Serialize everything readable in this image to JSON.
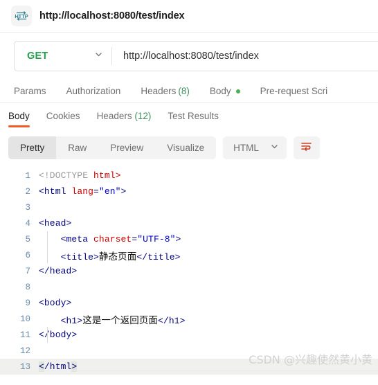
{
  "tabstrip": {
    "icon": "http-protocol-icon",
    "title": "http://localhost:8080/test/index"
  },
  "request_bar": {
    "method": "GET",
    "method_color": "#22a24c",
    "url": "http://localhost:8080/test/index",
    "chevron_icon": "chevron-down-icon"
  },
  "request_tabs": [
    {
      "label": "Params",
      "count": "",
      "dot": false,
      "active": false
    },
    {
      "label": "Authorization",
      "count": "",
      "dot": false,
      "active": false
    },
    {
      "label": "Headers",
      "count": "(8)",
      "dot": false,
      "active": false
    },
    {
      "label": "Body",
      "count": "",
      "dot": true,
      "active": false
    },
    {
      "label": "Pre-request Scri",
      "count": "",
      "dot": false,
      "active": false
    }
  ],
  "response_tabs": [
    {
      "label": "Body",
      "count": "",
      "active": true
    },
    {
      "label": "Cookies",
      "count": "",
      "active": false
    },
    {
      "label": "Headers",
      "count": "(12)",
      "active": false
    },
    {
      "label": "Test Results",
      "count": "",
      "active": false
    }
  ],
  "viewer_toolbar": {
    "modes": [
      {
        "label": "Pretty",
        "active": true
      },
      {
        "label": "Raw",
        "active": false
      },
      {
        "label": "Preview",
        "active": false
      },
      {
        "label": "Visualize",
        "active": false
      }
    ],
    "format": "HTML",
    "format_chevron_icon": "chevron-down-icon",
    "wrap_icon": "wrap-lines-icon",
    "wrap_icon_color": "#cc4125",
    "active_underline_color": "#ef5b25"
  },
  "code": {
    "language": "html",
    "lines": [
      {
        "n": "1",
        "indent": false,
        "active": false
      },
      {
        "n": "2",
        "indent": false,
        "active": false
      },
      {
        "n": "3",
        "indent": false,
        "active": false
      },
      {
        "n": "4",
        "indent": false,
        "active": false
      },
      {
        "n": "5",
        "indent": true,
        "active": false
      },
      {
        "n": "6",
        "indent": true,
        "active": false
      },
      {
        "n": "7",
        "indent": false,
        "active": false
      },
      {
        "n": "8",
        "indent": false,
        "active": false
      },
      {
        "n": "9",
        "indent": false,
        "active": false
      },
      {
        "n": "10",
        "indent": true,
        "active": false
      },
      {
        "n": "11",
        "indent": false,
        "active": false
      },
      {
        "n": "12",
        "indent": false,
        "active": false
      },
      {
        "n": "13",
        "indent": false,
        "active": true
      }
    ],
    "line_text": {
      "l1_doctype": "<!DOCTYPE ",
      "l1_html": "html>",
      "l2_a": "<html ",
      "l2_attr": "lang",
      "l2_eq": "=",
      "l2_val": "\"en\"",
      "l2_close": ">",
      "l3": "",
      "l4": "<head>",
      "l5_a": "    <meta ",
      "l5_attr": "charset",
      "l5_eq": "=",
      "l5_val": "\"UTF-8\"",
      "l5_close": ">",
      "l6_open": "    <title>",
      "l6_text": "静态页面",
      "l6_close": "</title>",
      "l7": "</head>",
      "l8": "",
      "l9": "<body>",
      "l10_open": "    <h1>",
      "l10_text": "这是一个返回页面",
      "l10_close": "</h1>",
      "l11": "</body>",
      "l12": "",
      "l13_lt": "<",
      "l13_mid": "/html",
      "l13_gt": ">"
    }
  },
  "watermark": {
    "text": "CSDN @兴趣使然黄小黄"
  }
}
